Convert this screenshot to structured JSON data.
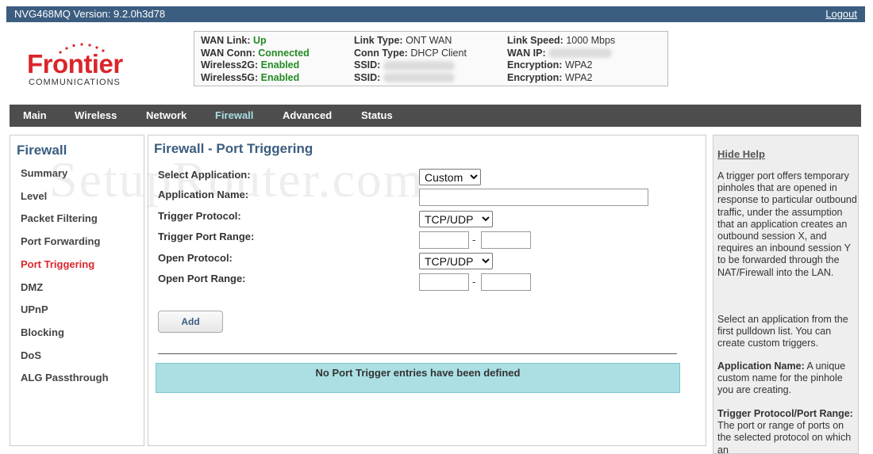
{
  "topbar": {
    "version": "NVG468MQ Version: 9.2.0h3d78",
    "logout": "Logout"
  },
  "logo": {
    "brand": "Frontier",
    "sub": "COMMUNICATIONS"
  },
  "status": {
    "wan_link_label": "WAN Link:",
    "wan_link_value": "Up",
    "wan_conn_label": "WAN Conn:",
    "wan_conn_value": "Connected",
    "wireless2g_label": "Wireless2G:",
    "wireless2g_value": "Enabled",
    "wireless5g_label": "Wireless5G:",
    "wireless5g_value": "Enabled",
    "link_type_label": "Link Type:",
    "link_type_value": "ONT WAN",
    "conn_type_label": "Conn Type:",
    "conn_type_value": "DHCP Client",
    "ssid1_label": "SSID:",
    "ssid2_label": "SSID:",
    "link_speed_label": "Link Speed:",
    "link_speed_value": "1000 Mbps",
    "wan_ip_label": "WAN IP:",
    "enc1_label": "Encryption:",
    "enc1_value": "WPA2",
    "enc2_label": "Encryption:",
    "enc2_value": "WPA2"
  },
  "nav": {
    "items": [
      "Main",
      "Wireless",
      "Network",
      "Firewall",
      "Advanced",
      "Status"
    ],
    "active": "Firewall"
  },
  "sidebar": {
    "title": "Firewall",
    "items": [
      "Summary",
      "Level",
      "Packet Filtering",
      "Port Forwarding",
      "Port Triggering",
      "DMZ",
      "UPnP",
      "Blocking",
      "DoS",
      "ALG Passthrough"
    ],
    "active": "Port Triggering"
  },
  "main": {
    "title": "Firewall - Port Triggering",
    "select_application_label": "Select Application:",
    "select_application_value": "Custom",
    "application_name_label": "Application Name:",
    "trigger_protocol_label": "Trigger Protocol:",
    "trigger_protocol_value": "TCP/UDP",
    "trigger_port_range_label": "Trigger Port Range:",
    "open_protocol_label": "Open Protocol:",
    "open_protocol_value": "TCP/UDP",
    "open_port_range_label": "Open Port Range:",
    "range_separator": "-",
    "add_label": "Add",
    "no_entries": "No Port Trigger entries have been defined"
  },
  "help": {
    "hide_label": "Hide Help",
    "p1": "A trigger port offers temporary pinholes that are opened in response to particular outbound traffic, under the assumption that an application creates an outbound session X, and requires an inbound session Y to be forwarded through the NAT/Firewall into the LAN.",
    "p2": "Select an application from the first pulldown list. You can create custom triggers.",
    "p3_bold": "Application Name:",
    "p3": " A unique custom name for the pinhole you are creating.",
    "p4_bold": "Trigger Protocol/Port Range:",
    "p4": " The port or range of ports on the selected protocol on which an"
  },
  "watermark": "SetupRouter.com",
  "colors": {
    "brand_red": "#d9262c",
    "header_blue": "#3b5d80",
    "nav_gray": "#4d4d4d",
    "nav_active": "#a8dfe4",
    "status_green": "#228b22",
    "notice_bg": "#abdfe3"
  }
}
